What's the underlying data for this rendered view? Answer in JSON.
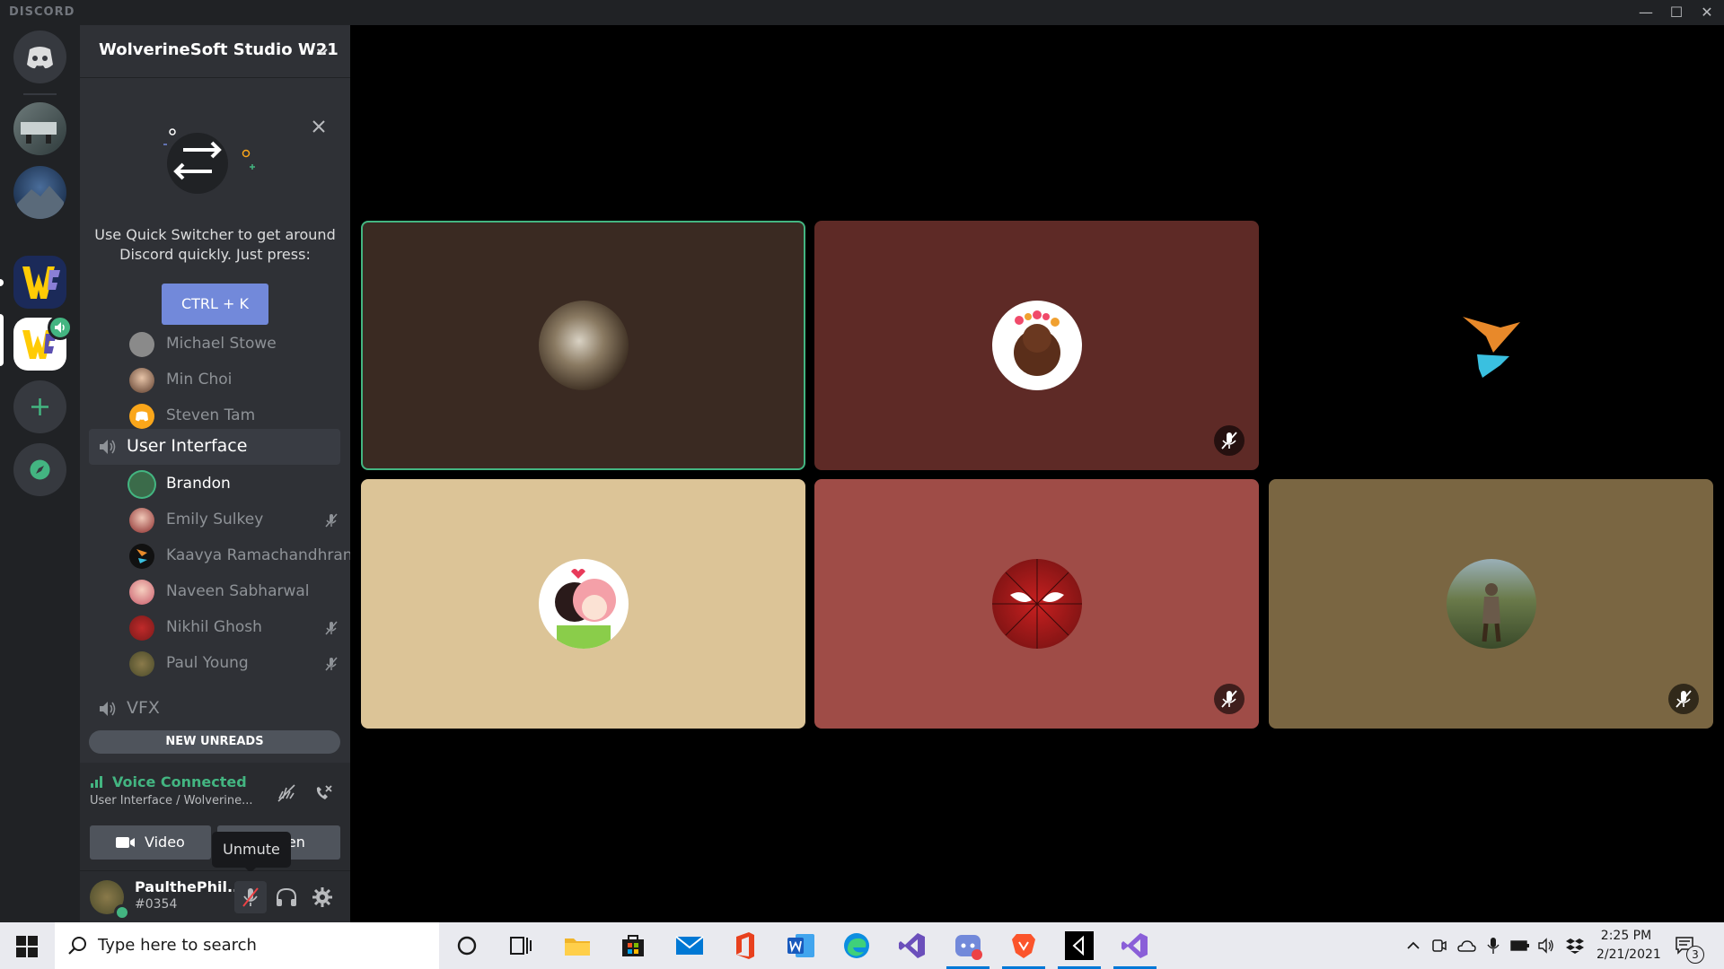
{
  "titlebar": {
    "brand": "DISCORD",
    "minimize": "—",
    "maximize": "☐",
    "close": "✕"
  },
  "server": {
    "name": "WolverineSoft Studio W21"
  },
  "quick_switcher": {
    "text_line1": "Use Quick Switcher to get around",
    "text_line2": "Discord quickly. Just press:",
    "shortcut": "CTRL + K"
  },
  "channels": {
    "prev_members": [
      {
        "name": "Michael Stowe"
      },
      {
        "name": "Min Choi"
      },
      {
        "name": "Steven Tam"
      }
    ],
    "user_interface": {
      "label": "User Interface"
    },
    "ui_members": [
      {
        "name": "Brandon",
        "muted": false,
        "active": true
      },
      {
        "name": "Emily Sulkey",
        "muted": true
      },
      {
        "name": "Kaavya Ramachandhran",
        "muted": false
      },
      {
        "name": "Naveen Sabharwal",
        "muted": false
      },
      {
        "name": "Nikhil Ghosh",
        "muted": true
      },
      {
        "name": "Paul Young",
        "muted": true
      }
    ],
    "vfx": {
      "label": "VFX"
    },
    "new_unreads": "NEW UNREADS"
  },
  "voice": {
    "status": "Voice Connected",
    "location": "User Interface / Wolverine...",
    "video_label": "Video",
    "screen_label": "een",
    "tooltip": "Unmute"
  },
  "user": {
    "name": "PaulthePhil...",
    "tag": "#0354"
  },
  "tiles": [
    {
      "bg": "#3a2a22",
      "speaking": true,
      "muted": false,
      "avatar": "dog"
    },
    {
      "bg": "#5e2a26",
      "muted": true,
      "avatar": "bear"
    },
    {
      "bg": "#000000",
      "muted": false,
      "avatar": "bird"
    },
    {
      "bg": "#dcc497",
      "muted": false,
      "avatar": "anime"
    },
    {
      "bg": "#9f4c47",
      "muted": true,
      "avatar": "spider"
    },
    {
      "bg": "#7a6642",
      "muted": true,
      "avatar": "knight"
    }
  ],
  "taskbar": {
    "search_placeholder": "Type here to search",
    "time": "2:25 PM",
    "date": "2/21/2021",
    "notifications": "3"
  },
  "colors": {
    "accent": "#7289da",
    "green": "#43b581",
    "sidebar": "#2f3136",
    "guildbar": "#202225"
  }
}
